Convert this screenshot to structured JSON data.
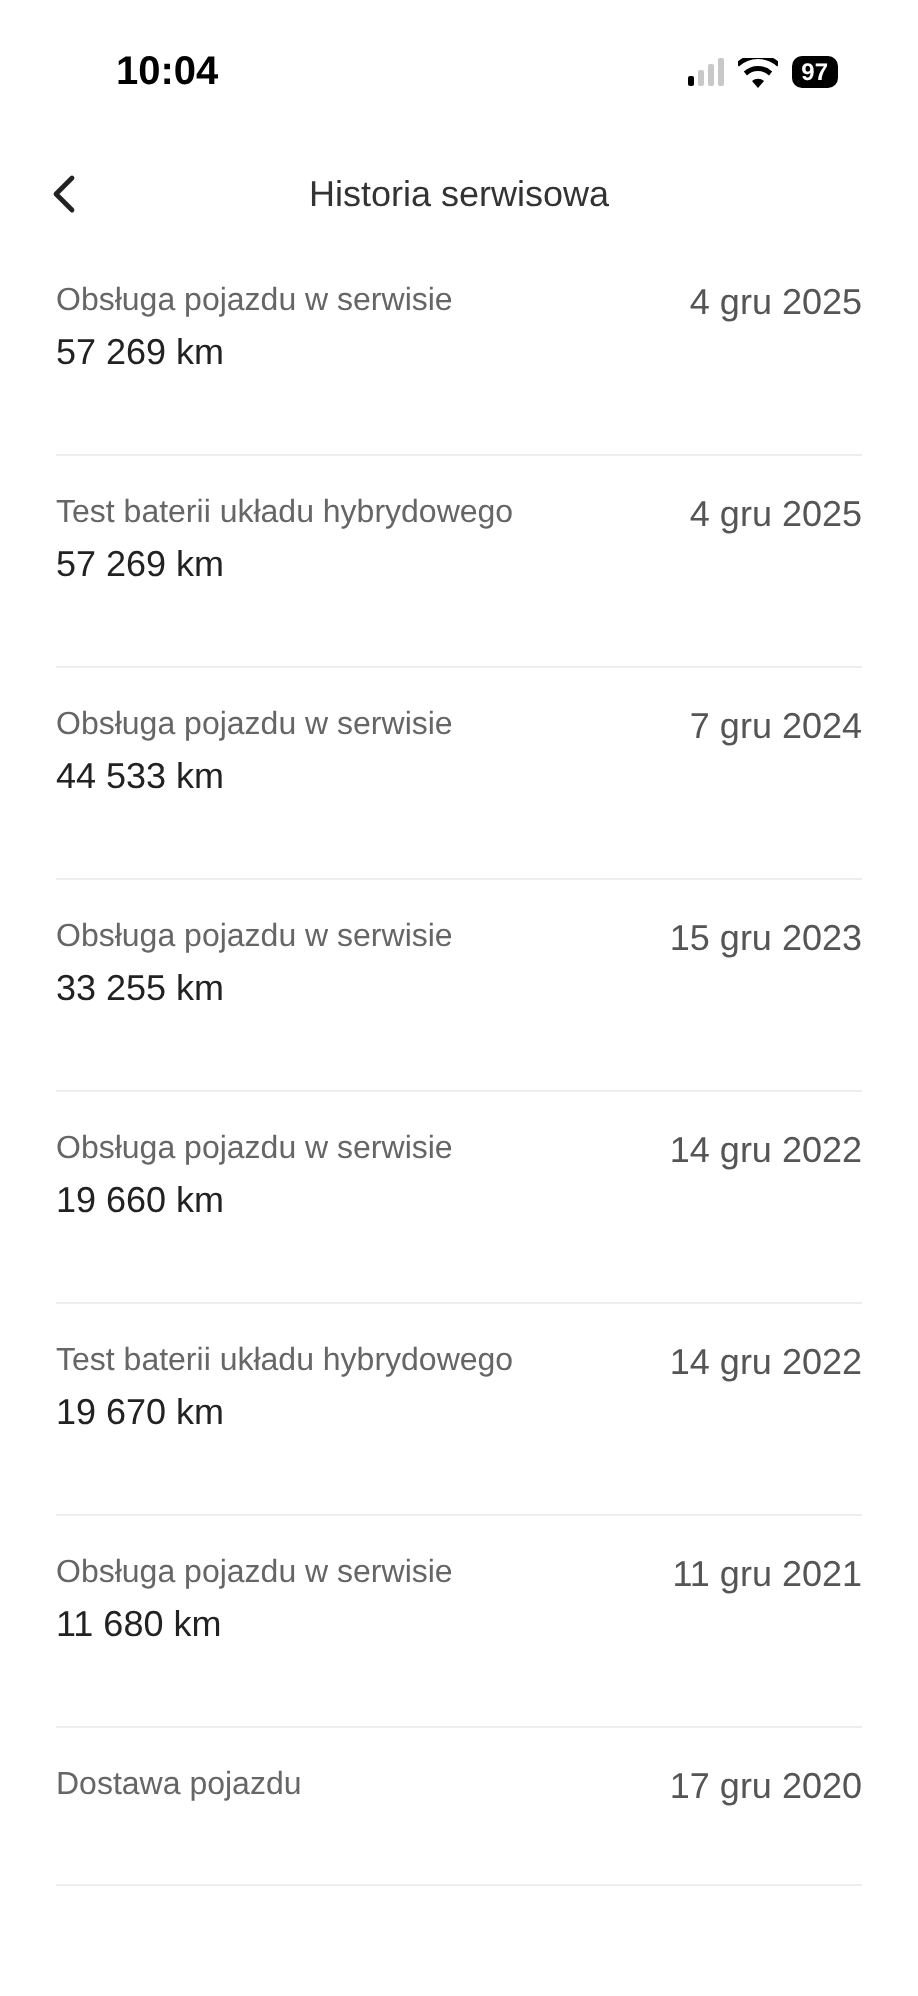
{
  "status_bar": {
    "time": "10:04",
    "battery": "97"
  },
  "nav": {
    "title": "Historia serwisowa"
  },
  "entries": [
    {
      "title": "Obsługa pojazdu w serwisie",
      "date": "4 gru 2025",
      "mileage": "57 269 km"
    },
    {
      "title": "Test baterii układu hybrydowego",
      "date": "4 gru 2025",
      "mileage": "57 269 km"
    },
    {
      "title": "Obsługa pojazdu w serwisie",
      "date": "7 gru 2024",
      "mileage": "44 533 km"
    },
    {
      "title": "Obsługa pojazdu w serwisie",
      "date": "15 gru 2023",
      "mileage": "33 255 km"
    },
    {
      "title": "Obsługa pojazdu w serwisie",
      "date": "14 gru 2022",
      "mileage": "19 660 km"
    },
    {
      "title": "Test baterii układu hybrydowego",
      "date": "14 gru 2022",
      "mileage": "19 670 km"
    },
    {
      "title": "Obsługa pojazdu w serwisie",
      "date": "11 gru 2021",
      "mileage": "11 680 km"
    },
    {
      "title": "Dostawa pojazdu",
      "date": "17 gru 2020"
    }
  ]
}
